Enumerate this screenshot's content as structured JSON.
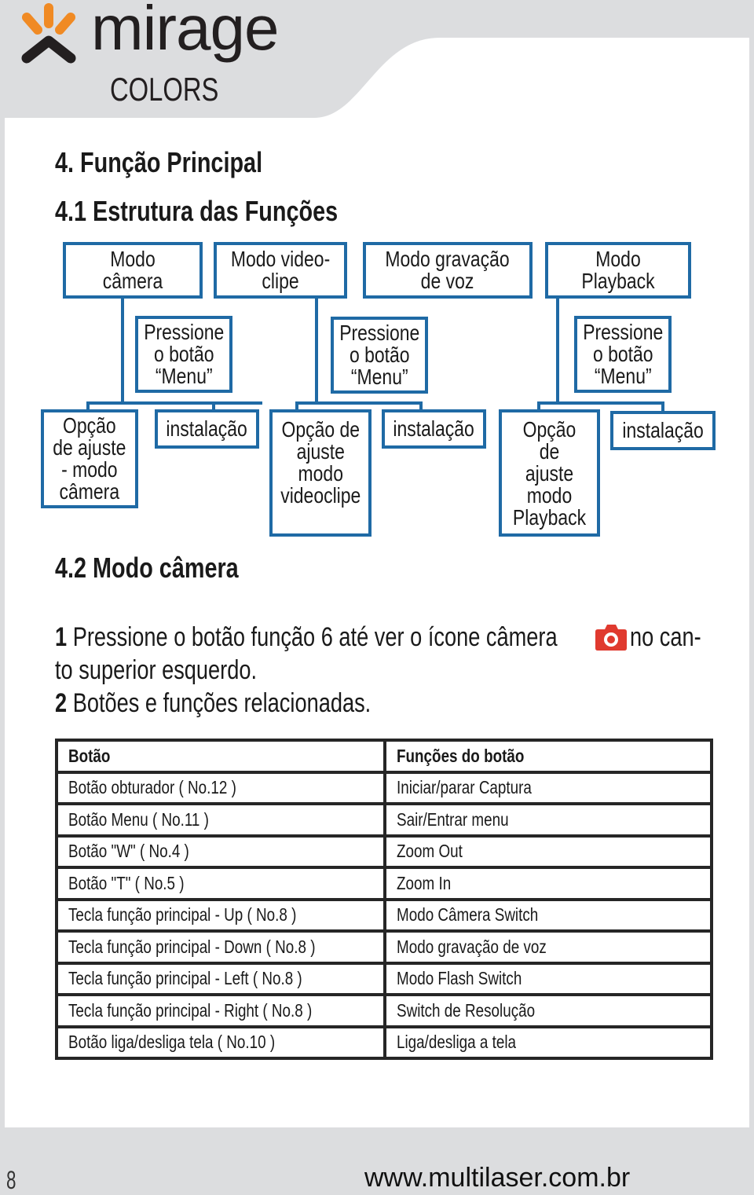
{
  "header": {
    "brand_name": "mirage",
    "brand_sub": "COLORS",
    "brand_colors": {
      "accent": "#f08a24",
      "dark": "#231f20"
    }
  },
  "section": {
    "title": "4. Função Principal",
    "subtitle": "4.1 Estrutura das Funções"
  },
  "diagram": {
    "line_color": "#1f6aa5",
    "modes": [
      "Modo câmera",
      "Modo video-\nclipe",
      "Modo gravação\nde voz",
      "Modo Playback"
    ],
    "press_menu": [
      "Pressione\no botão\n“Menu”",
      "Pressione\no botão\n“Menu”",
      "Pressione\no botão\n“Menu”"
    ],
    "options": [
      "Opção\nde ajuste\n- modo\ncâmera",
      "Opção de\najuste\nmodo\nvideoclipe",
      "Opção de\najuste\nmodo\nPlayback"
    ],
    "install": [
      "instalação",
      "instalação",
      "instalação"
    ]
  },
  "camera_mode": {
    "title": "4.2 Modo câmera",
    "step1_num": "1",
    "step1_text_a": " Pressione o botão função 6 até ver o ícone câmera ",
    "step1_text_b": " no can-",
    "step1_text_c": "to superior esquerdo.",
    "step2_num": "2",
    "step2_text": " Botões e funções relacionadas.",
    "camera_icon_color": "#e03a2f"
  },
  "table": {
    "headers": [
      "Botão",
      "Funções do botão"
    ],
    "rows": [
      [
        "Botão obturador ( No.12 )",
        "Iniciar/parar Captura"
      ],
      [
        "Botão Menu  ( No.11 )",
        "Sair/Entrar menu"
      ],
      [
        "Botão \"W\" ( No.4 )",
        "Zoom Out"
      ],
      [
        "Botão \"T\" ( No.5 )",
        "Zoom In"
      ],
      [
        "Tecla função principal - Up  ( No.8 )",
        "Modo Câmera Switch"
      ],
      [
        "Tecla função principal - Down  ( No.8 )",
        "Modo gravação de voz"
      ],
      [
        "Tecla função principal - Left  ( No.8 )",
        "Modo Flash Switch"
      ],
      [
        "Tecla função principal - Right  ( No.8 )",
        "Switch de Resolução"
      ],
      [
        "Botão liga/desliga tela  ( No.10 )",
        "Liga/desliga a tela"
      ]
    ]
  },
  "footer": {
    "page_number": "8",
    "website": "www.multilaser.com.br"
  }
}
